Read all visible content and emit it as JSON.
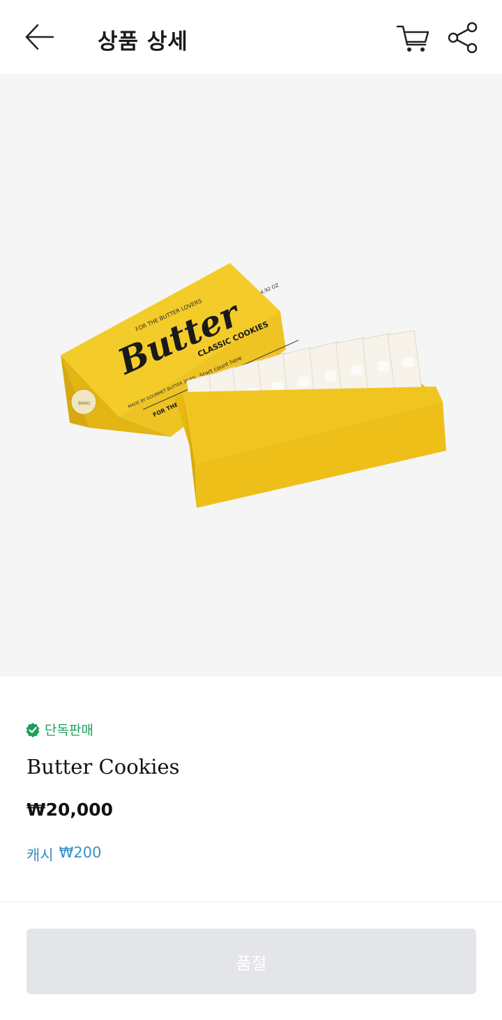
{
  "header": {
    "title": "상품 상세",
    "icons": {
      "back": "arrow-left-icon",
      "cart": "cart-icon",
      "share": "share-icon"
    }
  },
  "product": {
    "image": {
      "label_top": "FOR THE BUTTER LOVERS",
      "brand": "Butter",
      "sub": "CLASSIC COOKIES",
      "weight": "4.92 OZ",
      "side": "MADE BY GOURMET BUTTER 38.6%",
      "count": "Start count here",
      "edge": "FOR THE BUTTER",
      "seal": "BANG"
    },
    "badge": "단독판매",
    "name": "Butter Cookies",
    "price": "₩20,000",
    "cash_label": "캐시",
    "cash_value": "₩200"
  },
  "footer": {
    "button_label": "품절"
  },
  "colors": {
    "accent_green": "#1aa05a",
    "cash_blue": "#3a8fc4",
    "box_yellow": "#f2c21b"
  }
}
